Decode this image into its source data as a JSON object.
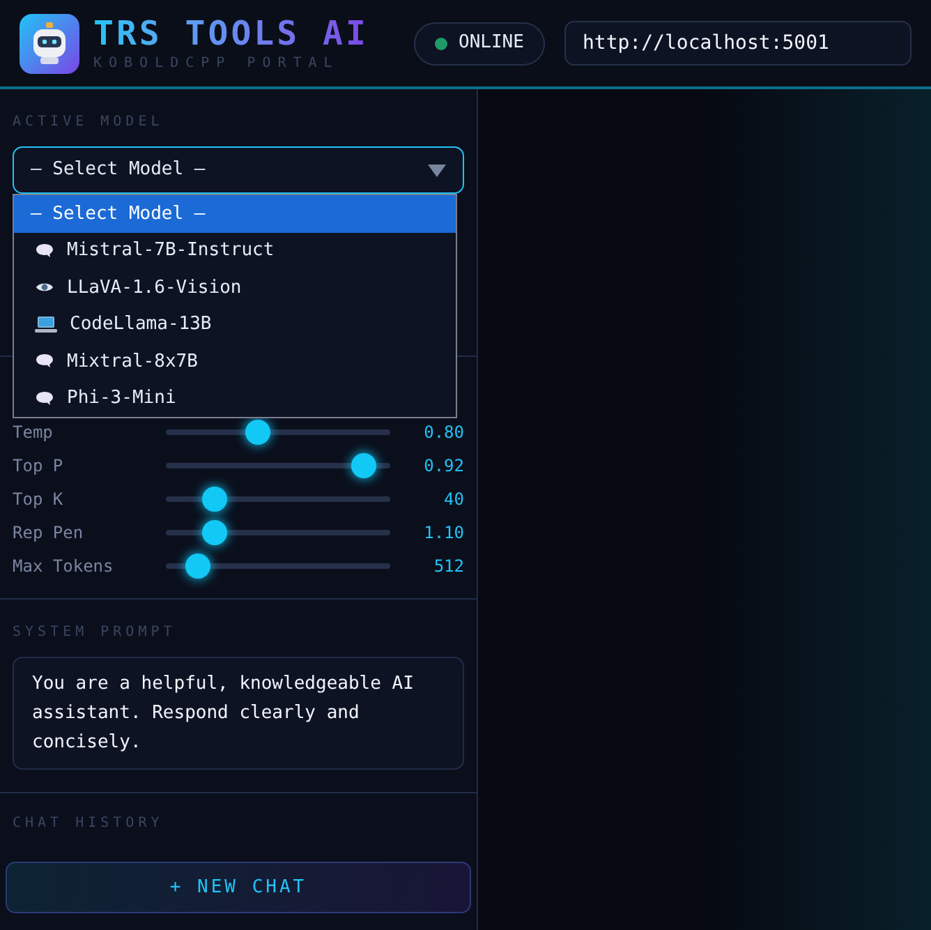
{
  "header": {
    "title": "TRS TOOLS AI",
    "subtitle": "KOBOLDCPP PORTAL",
    "status": {
      "label": "ONLINE",
      "online": true
    },
    "url": "http://localhost:5001"
  },
  "active_model": {
    "label": "ACTIVE MODEL",
    "value": "– Select Model –",
    "expanded": true,
    "options": [
      {
        "label": "– Select Model –",
        "selected": true
      },
      {
        "label": "Mistral-7B-Instruct",
        "kind": "chat",
        "selected": false
      },
      {
        "label": "LLaVA-1.6-Vision",
        "kind": "vision",
        "selected": false
      },
      {
        "label": "CodeLlama-13B",
        "kind": "code",
        "selected": false
      },
      {
        "label": "Mixtral-8x7B",
        "kind": "chat",
        "selected": false
      },
      {
        "label": "Phi-3-Mini",
        "kind": "chat",
        "selected": false
      }
    ]
  },
  "parameters": [
    {
      "name": "Temp",
      "level": 0.41,
      "reading": "0.80"
    },
    {
      "name": "Top P",
      "level": 0.88,
      "reading": "0.92"
    },
    {
      "name": "Top K",
      "level": 0.22,
      "reading": "40"
    },
    {
      "name": "Rep Pen",
      "level": 0.22,
      "reading": "1.10"
    },
    {
      "name": "Max Tokens",
      "level": 0.14,
      "reading": "512"
    }
  ],
  "system_prompt": {
    "label": "SYSTEM PROMPT",
    "value": "You are a helpful, knowledgeable AI assistant. Respond clearly and concisely."
  },
  "chat_history": {
    "label": "CHAT HISTORY",
    "new_chat": "+ NEW CHAT"
  }
}
